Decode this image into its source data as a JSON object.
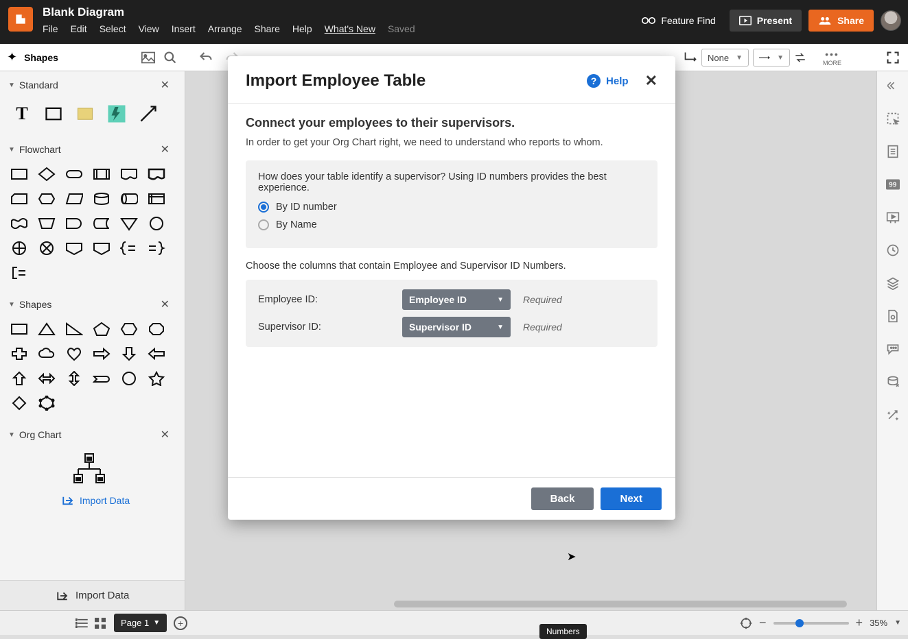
{
  "header": {
    "doc_title": "Blank Diagram",
    "menus": [
      "File",
      "Edit",
      "Select",
      "View",
      "Insert",
      "Arrange",
      "Share",
      "Help"
    ],
    "whats_new": "What's New",
    "saved": "Saved",
    "feature_find": "Feature Find",
    "present": "Present",
    "share": "Share"
  },
  "toolbar": {
    "shapes_label": "Shapes",
    "fill_none": "None",
    "more": "MORE"
  },
  "left_panel": {
    "sections": {
      "standard": "Standard",
      "flowchart": "Flowchart",
      "shapes": "Shapes",
      "org_chart": "Org Chart"
    },
    "import_link": "Import Data",
    "import_bottom": "Import Data"
  },
  "modal": {
    "title": "Import Employee Table",
    "help": "Help",
    "subtitle": "Connect your employees to their supervisors.",
    "description": "In order to get your Org Chart right, we need to understand who reports to whom.",
    "question": "How does your table identify a supervisor? Using ID numbers provides the best experience.",
    "radio_id": "By ID number",
    "radio_name": "By Name",
    "choose_cols": "Choose the columns that contain Employee and Supervisor ID Numbers.",
    "emp_label": "Employee ID:",
    "sup_label": "Supervisor ID:",
    "emp_value": "Employee ID",
    "sup_value": "Supervisor ID",
    "required": "Required",
    "back": "Back",
    "next": "Next"
  },
  "footer": {
    "page_tab": "Page 1",
    "zoom": "35%",
    "tooltip": "Numbers"
  }
}
